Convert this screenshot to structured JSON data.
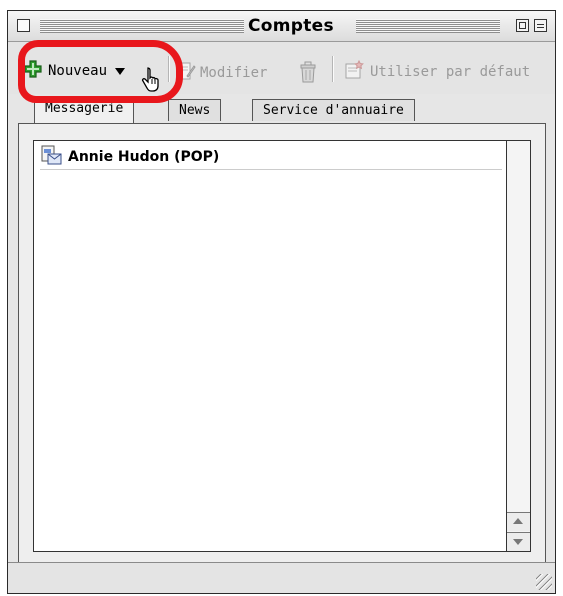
{
  "window": {
    "title": "Comptes"
  },
  "toolbar": {
    "new_label": "Nouveau",
    "edit_label": "Modifier",
    "default_label": "Utiliser par défaut"
  },
  "tabs": [
    {
      "label": "Messagerie",
      "active": true
    },
    {
      "label": "News",
      "active": false
    },
    {
      "label": "Service d'annuaire",
      "active": false
    }
  ],
  "accounts": [
    {
      "name": "Annie Hudon (POP)",
      "icon": "mail-account-icon"
    }
  ],
  "icons": [
    "close-box-icon",
    "zoom-box-icon",
    "collapse-box-icon",
    "plus-icon",
    "chevron-down-icon",
    "pointer-hand-icon",
    "edit-document-icon",
    "trash-icon",
    "default-account-icon",
    "mail-account-icon",
    "scroll-up-arrow-icon",
    "scroll-down-arrow-icon",
    "resize-grip-icon"
  ],
  "colors": {
    "highlight": "#e8171c",
    "plus_icon": "#2e9d2e"
  }
}
